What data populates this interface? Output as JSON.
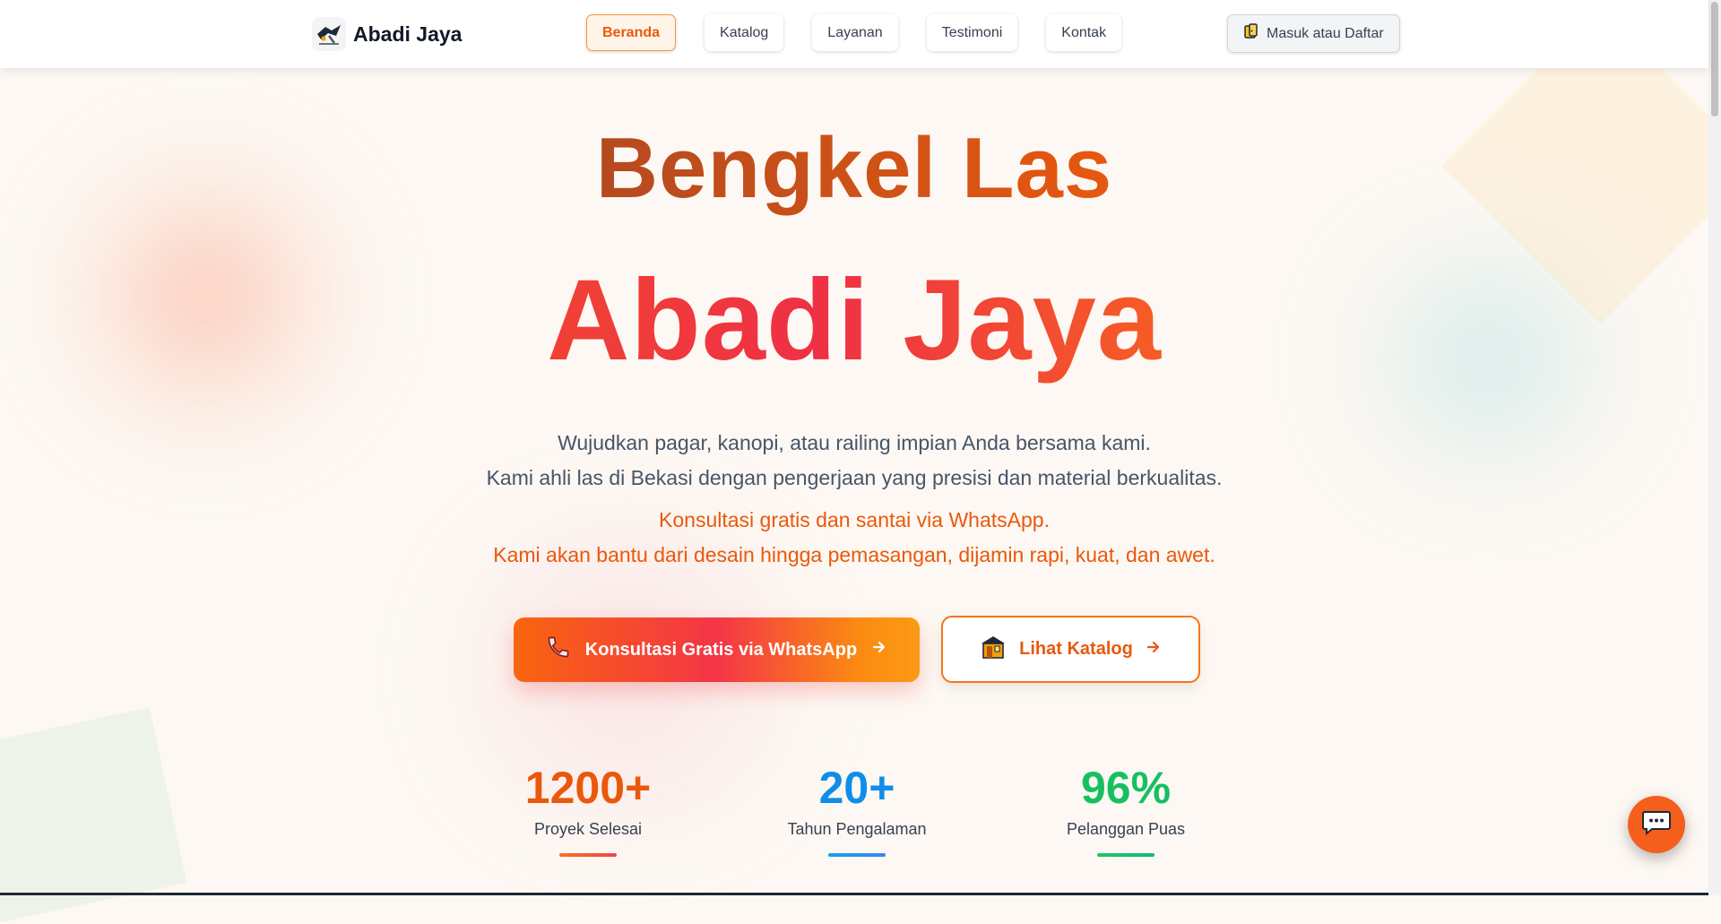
{
  "nav": {
    "brand_name": "Abadi Jaya",
    "links": [
      {
        "label": "Beranda"
      },
      {
        "label": "Katalog"
      },
      {
        "label": "Layanan"
      },
      {
        "label": "Testimoni"
      },
      {
        "label": "Kontak"
      }
    ],
    "login_label": "Masuk atau Daftar"
  },
  "hero": {
    "title_line1": "Bengkel Las",
    "title_line2": "Abadi Jaya",
    "description": [
      "Wujudkan pagar, kanopi, atau railing impian Anda bersama kami.",
      "Kami ahli las di Bekasi dengan pengerjaan yang presisi dan material berkualitas."
    ],
    "highlight": [
      "Konsultasi gratis dan santai via WhatsApp.",
      "Kami akan bantu dari desain hingga pemasangan, dijamin rapi, kuat, dan awet."
    ],
    "cta_primary": "Konsultasi Gratis via WhatsApp",
    "cta_secondary": "Lihat Katalog"
  },
  "stats": [
    {
      "value": "1200+",
      "label": "Proyek Selesai",
      "color": "#ea580c"
    },
    {
      "value": "20+",
      "label": "Tahun Pengalaman",
      "color": "#0e8ee9"
    },
    {
      "value": "96%",
      "label": "Pelanggan Puas",
      "color": "#16c060"
    }
  ],
  "icons": {
    "logo": "welding-logo-icon",
    "login": "door-icon",
    "cta_primary": "phone-icon",
    "cta_secondary": "gate-icon",
    "arrow": "arrow-right-icon",
    "chat": "chat-icon"
  },
  "colors": {
    "accent": "#f97316",
    "primary_text": "#ea580c"
  }
}
